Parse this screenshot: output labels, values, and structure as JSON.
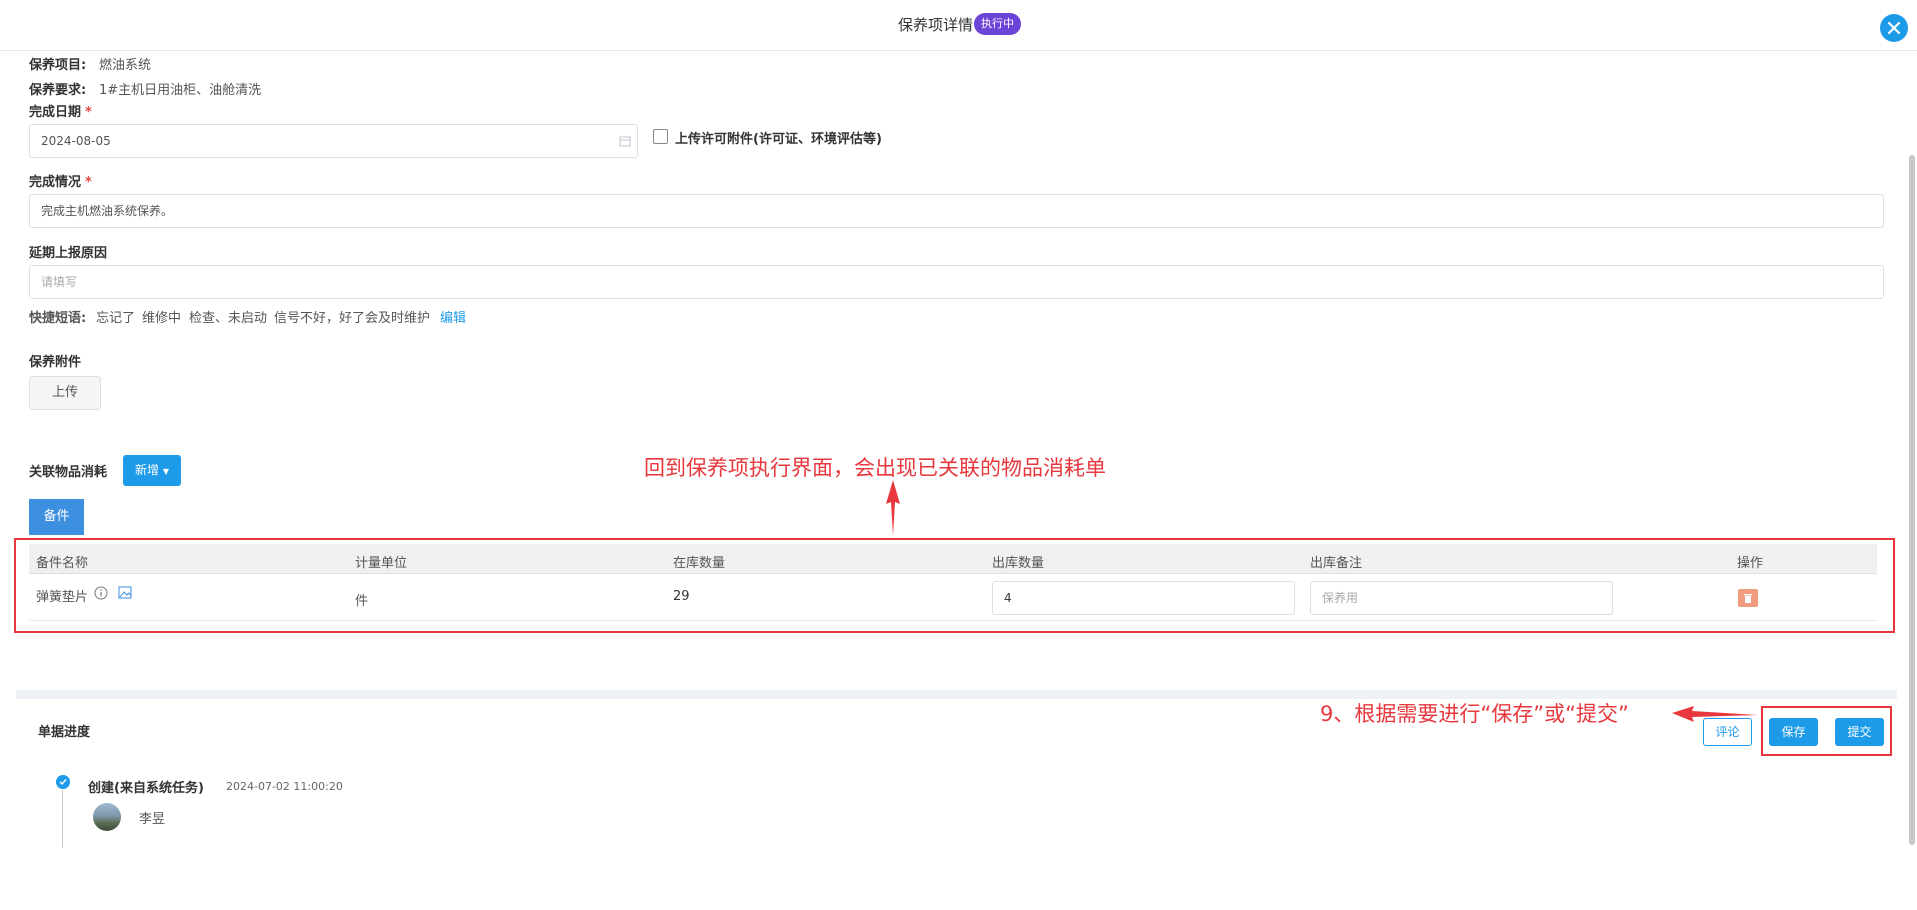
{
  "header": {
    "title": "保养项详情",
    "status": "执行中"
  },
  "info": {
    "item_label": "保养项目:",
    "item_value": "燃油系统",
    "req_label": "保养要求:",
    "req_value": "1#主机日用油柜、油舱清洗"
  },
  "form": {
    "date_label": "完成日期",
    "date_value": "2024-08-05",
    "upload_permit_label": "上传许可附件(许可证、环境评估等)",
    "status_label": "完成情况",
    "status_value": "完成主机燃油系统保养。",
    "delay_label": "延期上报原因",
    "delay_placeholder": "请填写",
    "phrases_label": "快捷短语:",
    "phrases": [
      "忘记了",
      "维修中",
      "检查、未启动",
      "信号不好，好了会及时维护"
    ],
    "edit_label": "编辑",
    "attachment_label": "保养附件",
    "upload_label": "上传",
    "required_mark": "*"
  },
  "consumption": {
    "title": "关联物品消耗",
    "add_label": "新增",
    "tab_label": "备件",
    "columns": [
      "备件名称",
      "计量单位",
      "在库数量",
      "出库数量",
      "出库备注",
      "操作"
    ],
    "rows": [
      {
        "name": "弹簧垫片",
        "unit": "件",
        "stock": "29",
        "out_qty": "4",
        "remark_placeholder": "保养用"
      }
    ]
  },
  "annotations": {
    "top": "回到保养项执行界面，会出现已关联的物品消耗单",
    "bottom": "9、根据需要进行“保存”或“提交”"
  },
  "progress": {
    "title": "单据进度",
    "comment_label": "评论",
    "save_label": "保存",
    "submit_label": "提交",
    "entry_title": "创建(来自系统任务)",
    "entry_time": "2024-07-02 11:00:20",
    "entry_user": "李昱"
  },
  "colors": {
    "accent": "#1e9be8",
    "status_badge": "#6d44d8",
    "annotation_red": "#e8383d"
  }
}
